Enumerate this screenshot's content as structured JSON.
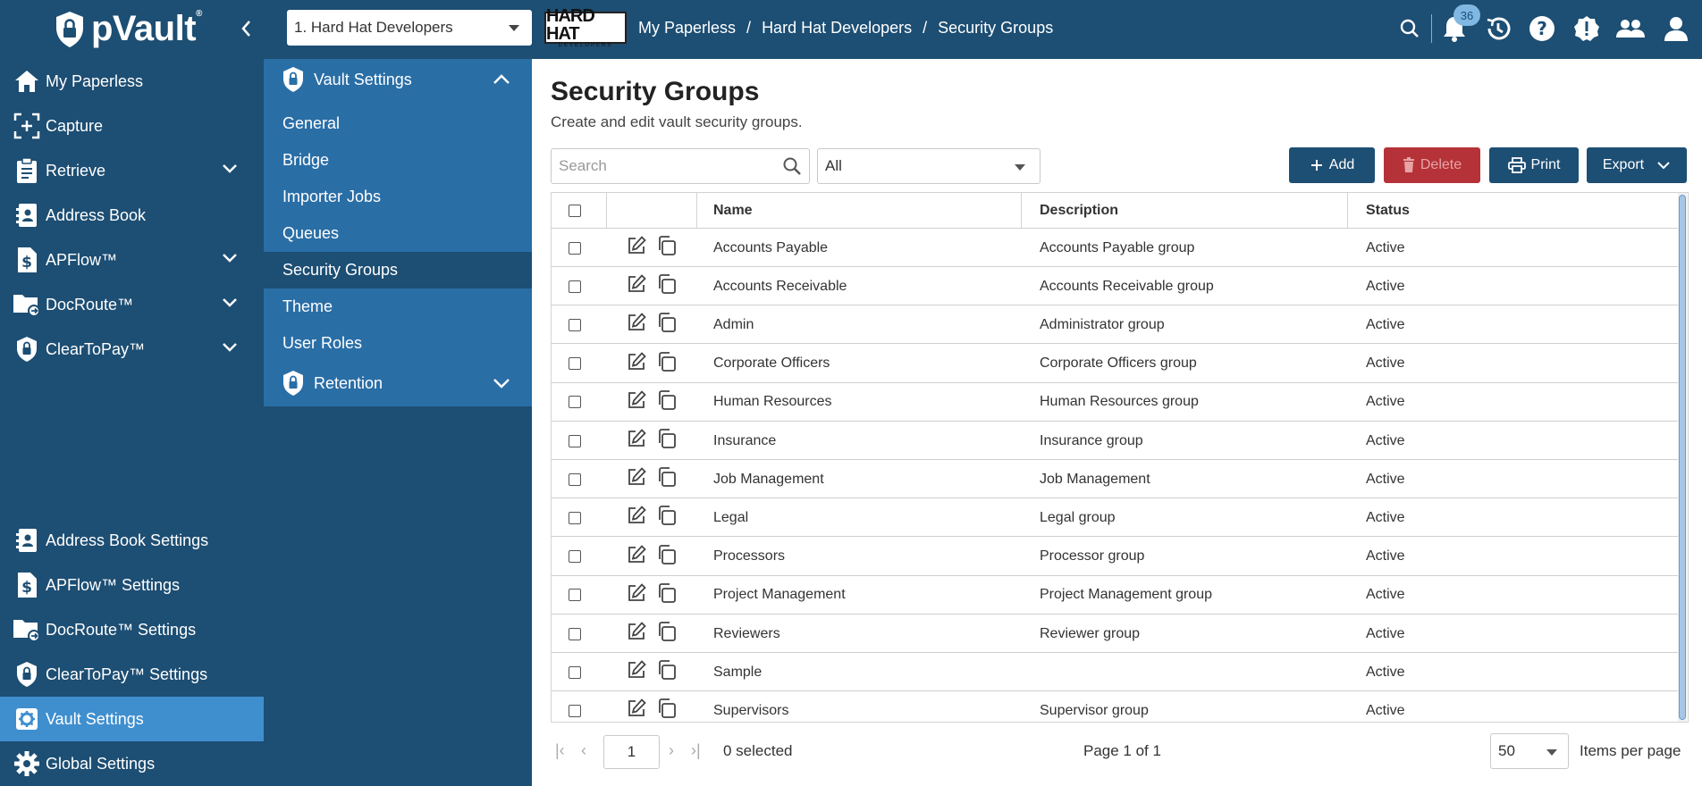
{
  "app": {
    "logo_text": "pVault",
    "logo_mark": "®"
  },
  "header": {
    "vault_select": "1. Hard Hat Developers",
    "company_logo": {
      "main": "HARD HAT",
      "sub": "DEVELOPERS"
    },
    "breadcrumb": [
      "My Paperless",
      "Hard Hat Developers",
      "Security Groups"
    ],
    "breadcrumb_sep": "/",
    "notification_count": "36",
    "icons": [
      "search-icon",
      "bell-icon",
      "history-icon",
      "help-icon",
      "alert-icon",
      "users-icon",
      "profile-icon"
    ]
  },
  "sidebar": {
    "items": [
      {
        "label": "My Paperless",
        "icon": "home-icon"
      },
      {
        "label": "Capture",
        "icon": "capture-icon"
      },
      {
        "label": "Retrieve",
        "icon": "retrieve-icon"
      },
      {
        "label": "Address Book",
        "icon": "address-book-icon"
      },
      {
        "label": "APFlow™",
        "icon": "apflow-icon"
      },
      {
        "label": "DocRoute™",
        "icon": "docroute-icon"
      },
      {
        "label": "ClearToPay™",
        "icon": "cleartopay-icon"
      }
    ],
    "settings": [
      {
        "label": "Address Book Settings",
        "icon": "address-book-icon"
      },
      {
        "label": "APFlow™ Settings",
        "icon": "apflow-icon"
      },
      {
        "label": "DocRoute™ Settings",
        "icon": "docroute-icon"
      },
      {
        "label": "ClearToPay™ Settings",
        "icon": "cleartopay-icon"
      },
      {
        "label": "Vault Settings",
        "icon": "gear-icon"
      },
      {
        "label": "Global Settings",
        "icon": "gear-icon"
      }
    ]
  },
  "subnav": {
    "section_title": "Vault Settings",
    "items": [
      "General",
      "Bridge",
      "Importer Jobs",
      "Queues",
      "Security Groups",
      "Theme",
      "User Roles"
    ],
    "retention_title": "Retention"
  },
  "main": {
    "title": "Security Groups",
    "subtitle": "Create and edit vault security groups.",
    "search_placeholder": "Search",
    "filter_value": "All",
    "buttons": {
      "add": "Add",
      "delete": "Delete",
      "print": "Print",
      "export": "Export"
    }
  },
  "table": {
    "columns": [
      "Name",
      "Description",
      "Status"
    ],
    "rows": [
      {
        "name": "Accounts Payable",
        "description": "Accounts Payable group",
        "status": "Active"
      },
      {
        "name": "Accounts Receivable",
        "description": "Accounts Receivable group",
        "status": "Active"
      },
      {
        "name": "Admin",
        "description": "Administrator group",
        "status": "Active"
      },
      {
        "name": "Corporate Officers",
        "description": "Corporate Officers group",
        "status": "Active"
      },
      {
        "name": "Human Resources",
        "description": "Human Resources group",
        "status": "Active"
      },
      {
        "name": "Insurance",
        "description": "Insurance group",
        "status": "Active"
      },
      {
        "name": "Job Management",
        "description": "Job Management",
        "status": "Active"
      },
      {
        "name": "Legal",
        "description": "Legal group",
        "status": "Active"
      },
      {
        "name": "Processors",
        "description": "Processor group",
        "status": "Active"
      },
      {
        "name": "Project Management",
        "description": "Project Management group",
        "status": "Active"
      },
      {
        "name": "Reviewers",
        "description": "Reviewer group",
        "status": "Active"
      },
      {
        "name": "Sample",
        "description": "",
        "status": "Active"
      },
      {
        "name": "Supervisors",
        "description": "Supervisor group",
        "status": "Active"
      }
    ]
  },
  "pager": {
    "page": "1",
    "selected": "0 selected",
    "page_of": "Page 1 of 1",
    "page_size": "50",
    "items_per_page": "Items per page"
  },
  "colors": {
    "primary": "#1d4e73",
    "accent": "#3f8fcf",
    "subnav": "#2a6ea6",
    "danger": "#b53338"
  }
}
